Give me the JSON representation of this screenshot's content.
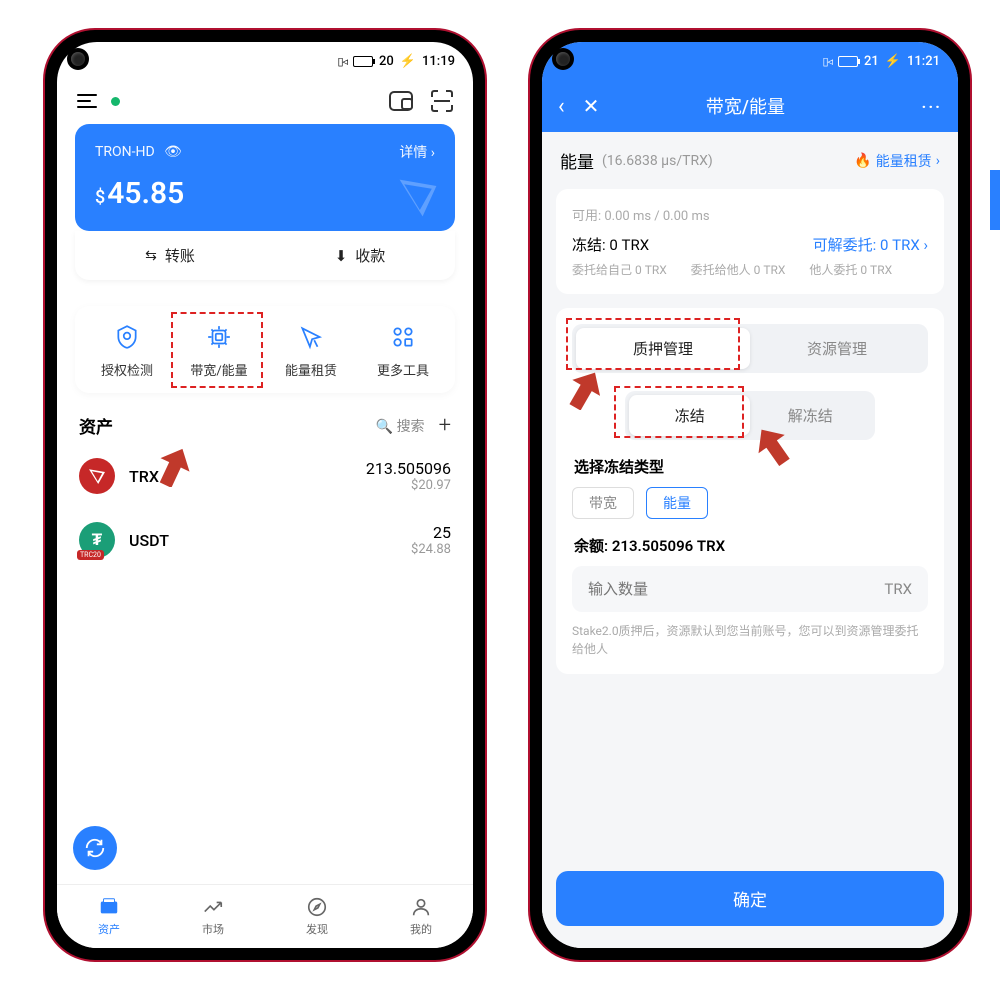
{
  "left": {
    "status_time": "11:19",
    "status_batt": "20",
    "wallet_name": "TRON-HD",
    "details": "详情",
    "balance": "45.85",
    "currency": "$",
    "action_transfer": "转账",
    "action_receive": "收款",
    "tools": {
      "auth": "授权检测",
      "bw": "带宽/能量",
      "rent": "能量租赁",
      "more": "更多工具"
    },
    "assets_title": "资产",
    "search": "搜索",
    "coins": [
      {
        "sym": "TRX",
        "amount": "213.505096",
        "usd": "$20.97"
      },
      {
        "sym": "USDT",
        "amount": "25",
        "usd": "$24.88"
      }
    ],
    "nav": {
      "assets": "资产",
      "market": "市场",
      "discover": "发现",
      "me": "我的"
    }
  },
  "right": {
    "status_time": "11:21",
    "status_batt": "21",
    "title": "带宽/能量",
    "energy_label": "能量",
    "energy_rate": "(16.6838 μs/TRX)",
    "rent_btn": "能量租赁",
    "available": "可用: 0.00 ms / 0.00 ms",
    "freeze_label": "冻结: 0 TRX",
    "delegable": "可解委托: 0 TRX",
    "d_self": "委托给自己 0 TRX",
    "d_other": "委托给他人 0 TRX",
    "d_from": "他人委托 0 TRX",
    "tab_stake": "质押管理",
    "tab_res": "资源管理",
    "tab_freeze": "冻结",
    "tab_unfreeze": "解冻结",
    "choose_type": "选择冻结类型",
    "pill_bw": "带宽",
    "pill_energy": "能量",
    "balance_line": "余额: 213.505096 TRX",
    "input_ph": "输入数量",
    "input_unit": "TRX",
    "hint": "Stake2.0质押后，资源默认到您当前账号，您可以到资源管理委托给他人",
    "confirm": "确定"
  }
}
